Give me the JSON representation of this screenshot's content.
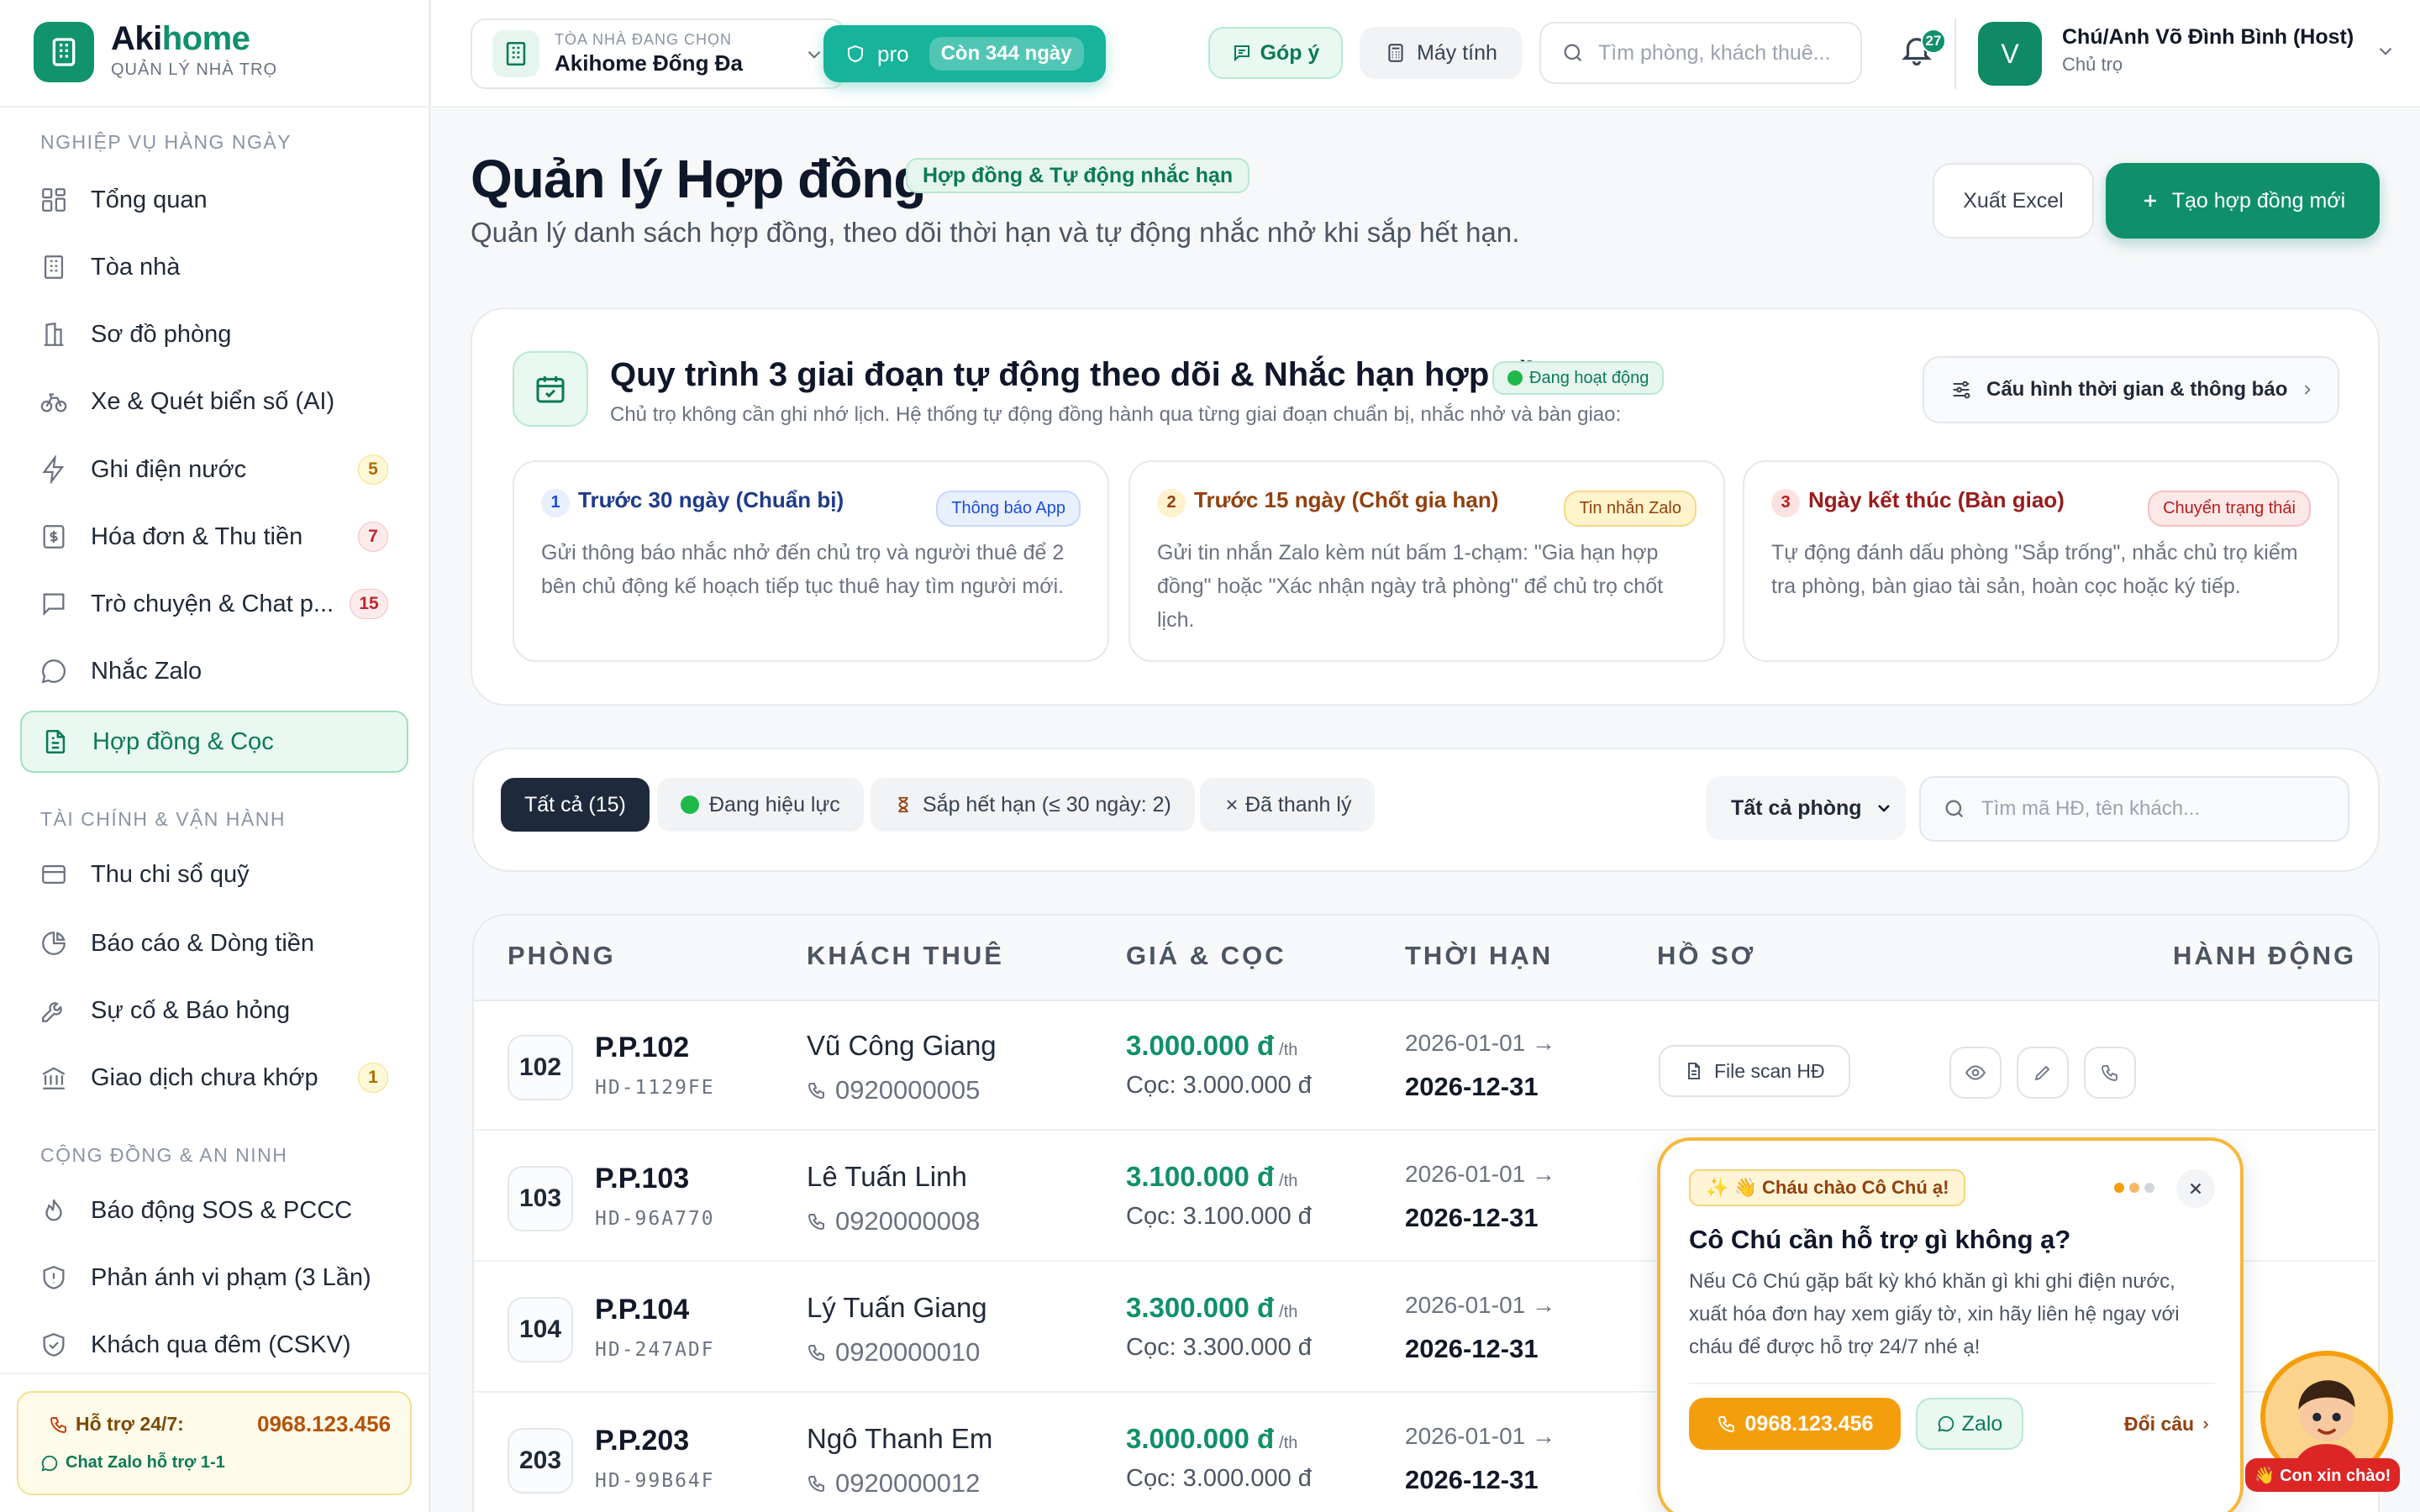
{
  "brand": {
    "name_a": "Aki",
    "name_b": "home",
    "subtitle": "QUẢN LÝ NHÀ TRỌ"
  },
  "sidebar": {
    "sections": [
      "NGHIỆP VỤ HÀNG NGÀY",
      "TÀI CHÍNH & VẬN HÀNH",
      "CỘNG ĐỒNG & AN NINH"
    ],
    "items": [
      {
        "label": "Tổng quan",
        "icon": "dashboard-icon"
      },
      {
        "label": "Tòa nhà",
        "icon": "building-icon"
      },
      {
        "label": "Sơ đồ phòng",
        "icon": "floorplan-icon"
      },
      {
        "label": "Xe & Quét biển số (AI)",
        "icon": "bike-icon"
      },
      {
        "label": "Ghi điện nước",
        "icon": "lightning-icon",
        "badge": "5"
      },
      {
        "label": "Hóa đơn & Thu tiền",
        "icon": "invoice-icon",
        "badge": "7"
      },
      {
        "label": "Trò chuyện & Chat p...",
        "icon": "chat-icon",
        "badge": "15"
      },
      {
        "label": "Nhắc Zalo",
        "icon": "message-icon"
      },
      {
        "label": "Hợp đồng & Cọc",
        "icon": "contract-icon"
      },
      {
        "label": "Thu chi sổ quỹ",
        "icon": "wallet-icon"
      },
      {
        "label": "Báo cáo & Dòng tiền",
        "icon": "pie-chart-icon"
      },
      {
        "label": "Sự cố & Báo hỏng",
        "icon": "wrench-icon"
      },
      {
        "label": "Giao dịch chưa khớp",
        "icon": "bank-icon",
        "badge": "1"
      },
      {
        "label": "Báo động SOS & PCCC",
        "icon": "flame-icon"
      },
      {
        "label": "Phản ánh vi phạm (3 Lần)",
        "icon": "shield-alert-icon"
      },
      {
        "label": "Khách qua đêm (CSKV)",
        "icon": "shield-check-icon"
      }
    ],
    "support": {
      "label": "Hỗ trợ 24/7:",
      "phone": "0968.123.456",
      "zalo": "Chat Zalo hỗ trợ 1-1"
    }
  },
  "header": {
    "building_caption": "TÒA NHÀ ĐANG CHỌN",
    "building_name": "Akihome Đống Đa",
    "plan": "pro",
    "plan_remaining": "Còn 344 ngày",
    "feedback": "Góp ý",
    "calculator": "Máy tính",
    "search_placeholder": "Tìm phòng, khách thuê...",
    "notifications": "27",
    "user_initial": "V",
    "user_name": "Chú/Anh Võ Đình Bình (Host)",
    "user_role": "Chủ trọ"
  },
  "page": {
    "title": "Quản lý Hợp đồng",
    "title_tag": "Hợp đồng & Tự động nhắc hạn",
    "subtitle": "Quản lý danh sách hợp đồng, theo dõi thời hạn và tự động nhắc nhở khi sắp hết hạn.",
    "export_label": "Xuất Excel",
    "create_label": "Tạo hợp đồng mới"
  },
  "workflow": {
    "title": "Quy trình 3 giai đoạn tự động theo dõi & Nhắc hạn hợp đồng",
    "status": "Đang hoạt động",
    "desc": "Chủ trọ không cần ghi nhớ lịch. Hệ thống tự động đồng hành qua từng giai đoạn chuẩn bị, nhắc nhở và bàn giao:",
    "config_label": "Cấu hình thời gian & thông báo",
    "stages": [
      {
        "num": "1",
        "title": "Trước 30 ngày (Chuẩn bị)",
        "tag": "Thông báo App",
        "desc": "Gửi thông báo nhắc nhở đến chủ trọ và người thuê để 2 bên chủ động kế hoạch tiếp tục thuê hay tìm người mới."
      },
      {
        "num": "2",
        "title": "Trước 15 ngày (Chốt gia hạn)",
        "tag": "Tin nhắn Zalo",
        "desc": "Gửi tin nhắn Zalo kèm nút bấm 1-chạm: \"Gia hạn hợp đồng\" hoặc \"Xác nhận ngày trả phòng\" để chủ trọ chốt lịch."
      },
      {
        "num": "3",
        "title": "Ngày kết thúc (Bàn giao)",
        "tag": "Chuyển trạng thái",
        "desc": "Tự động đánh dấu phòng \"Sắp trống\", nhắc chủ trọ kiểm tra phòng, bàn giao tài sản, hoàn cọc hoặc ký tiếp."
      }
    ]
  },
  "filters": {
    "tabs": [
      "Tất cả (15)",
      "Đang hiệu lực",
      "Sắp hết hạn (≤ 30 ngày: 2)",
      "Đã thanh lý"
    ],
    "room_select": "Tất cả phòng",
    "search_placeholder": "Tìm mã HĐ, tên khách..."
  },
  "table": {
    "headers": [
      "PHÒNG",
      "KHÁCH THUÊ",
      "GIÁ & CỌC",
      "THỜI HẠN",
      "HỒ SƠ",
      "HÀNH ĐỘNG"
    ],
    "per_month": "/th",
    "file_label": "File scan HĐ",
    "rows": [
      {
        "num": "102",
        "name": "P.P.102",
        "code": "HD-1129FE",
        "tenant": "Vũ Công Giang",
        "phone": "0920000005",
        "price": "3.000.000 đ",
        "deposit": "Cọc: 3.000.000 đ",
        "from": "2026-01-01 →",
        "to": "2026-12-31"
      },
      {
        "num": "103",
        "name": "P.P.103",
        "code": "HD-96A770",
        "tenant": "Lê Tuấn Linh",
        "phone": "0920000008",
        "price": "3.100.000 đ",
        "deposit": "Cọc: 3.100.000 đ",
        "from": "2026-01-01 →",
        "to": "2026-12-31"
      },
      {
        "num": "104",
        "name": "P.P.104",
        "code": "HD-247ADF",
        "tenant": "Lý Tuấn Giang",
        "phone": "0920000010",
        "price": "3.300.000 đ",
        "deposit": "Cọc: 3.300.000 đ",
        "from": "2026-01-01 →",
        "to": "2026-12-31"
      },
      {
        "num": "203",
        "name": "P.P.203",
        "code": "HD-99B64F",
        "tenant": "Ngô Thanh Em",
        "phone": "0920000012",
        "price": "3.000.000 đ",
        "deposit": "Cọc: 3.000.000 đ",
        "from": "2026-01-01 →",
        "to": "2026-12-31"
      }
    ]
  },
  "chat": {
    "greeting_tag": "✨ 👋 Cháu chào Cô Chú ạ!",
    "title": "Cô Chú cần hỗ trợ gì không ạ?",
    "body": "Nếu Cô Chú gặp bất kỳ khó khăn gì khi ghi điện nước, xuất hóa đơn hay xem giấy tờ, xin hãy liên hệ ngay với cháu để được hỗ trợ 24/7 nhé ạ!",
    "phone": "0968.123.456",
    "zalo": "Zalo",
    "change": "Đổi câu",
    "mascot_label": "👋 Con xin chào!"
  }
}
